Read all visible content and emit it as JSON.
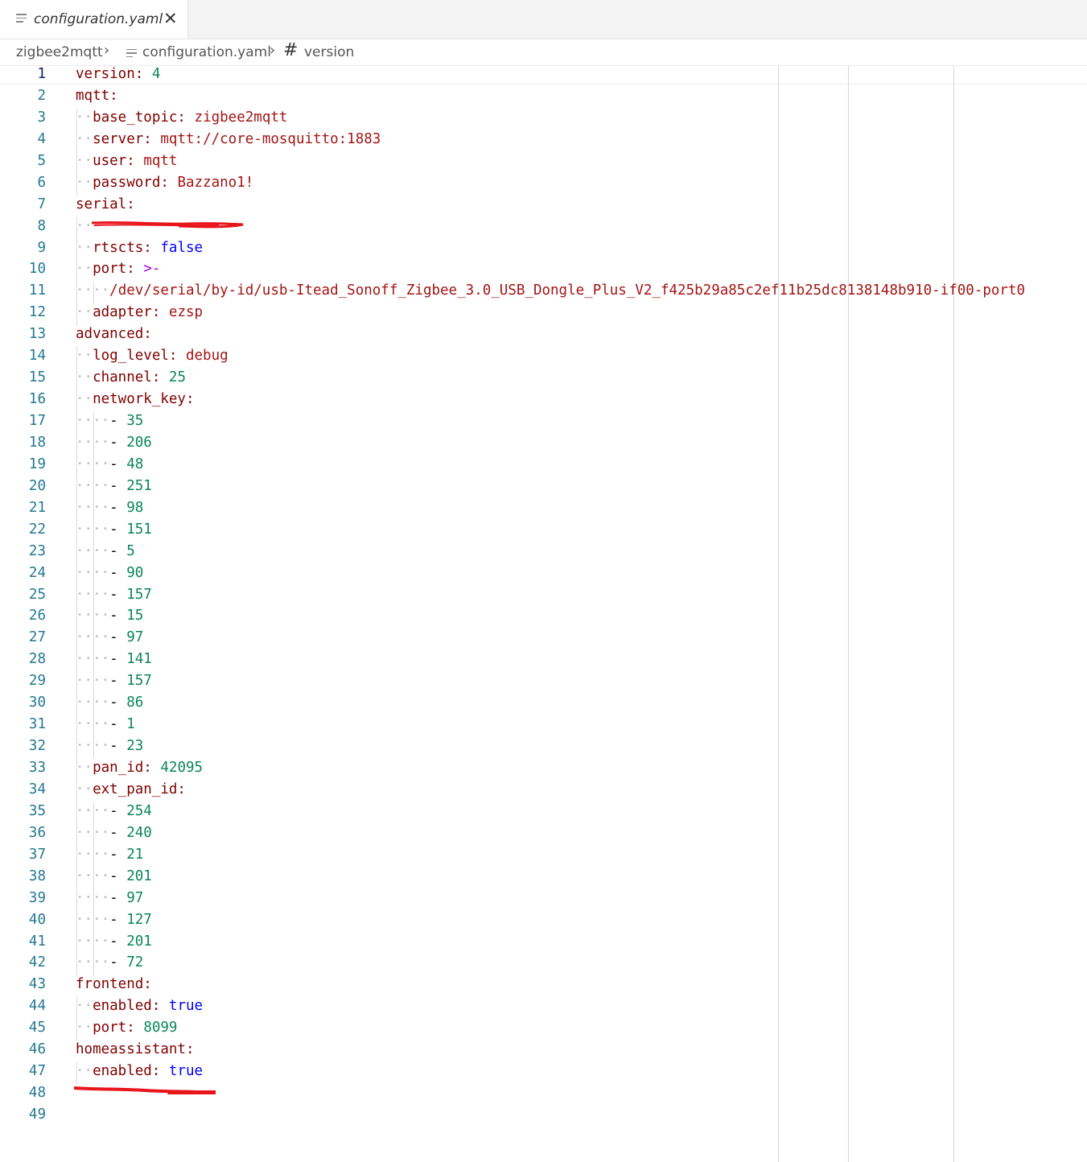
{
  "tab": {
    "title": "configuration.yaml",
    "close_glyph": "✕",
    "file_icon": "file-lines-icon"
  },
  "breadcrumb": {
    "folder": "zigbee2mqtt",
    "file": "configuration.yaml",
    "symbol_glyph": "#",
    "symbol": "version",
    "separator": "›"
  },
  "editor": {
    "active_line": 1,
    "colors": {
      "key": "#800000",
      "string": "#a31515",
      "number": "#098658",
      "boolean": "#0000ff",
      "operator": "#af00db",
      "line_number": "#237893",
      "redaction": "#e8151b"
    },
    "lines": [
      {
        "n": "1",
        "tokens": [
          {
            "t": "version:",
            "c": "k"
          },
          {
            "t": " "
          },
          {
            "t": "4",
            "c": "n"
          }
        ]
      },
      {
        "n": "2",
        "tokens": [
          {
            "t": "mqtt:",
            "c": "k"
          }
        ]
      },
      {
        "n": "3",
        "indent": 1,
        "tokens": [
          {
            "t": "base_topic:",
            "c": "k"
          },
          {
            "t": " "
          },
          {
            "t": "zigbee2mqtt",
            "c": "s"
          }
        ]
      },
      {
        "n": "4",
        "indent": 1,
        "tokens": [
          {
            "t": "server:",
            "c": "k"
          },
          {
            "t": " "
          },
          {
            "t": "mqtt://core-mosquitto:1883",
            "c": "s"
          }
        ]
      },
      {
        "n": "5",
        "indent": 1,
        "tokens": [
          {
            "t": "user:",
            "c": "k"
          },
          {
            "t": " "
          },
          {
            "t": "mqtt",
            "c": "s"
          }
        ]
      },
      {
        "n": "6",
        "indent": 1,
        "tokens": [
          {
            "t": "password:",
            "c": "k"
          },
          {
            "t": " "
          },
          {
            "t": "Bazzano1!",
            "c": "s"
          }
        ]
      },
      {
        "n": "7",
        "tokens": [
          {
            "t": "serial:",
            "c": "k"
          }
        ]
      },
      {
        "n": "8",
        "indent": 1,
        "redact": 1,
        "tokens": []
      },
      {
        "n": "9",
        "indent": 1,
        "tokens": [
          {
            "t": "rtscts:",
            "c": "k"
          },
          {
            "t": " "
          },
          {
            "t": "false",
            "c": "b"
          }
        ]
      },
      {
        "n": "10",
        "indent": 1,
        "tokens": [
          {
            "t": "port:",
            "c": "k"
          },
          {
            "t": " "
          },
          {
            "t": ">-",
            "c": "p"
          }
        ]
      },
      {
        "n": "11",
        "indent": 2,
        "tokens": [
          {
            "t": "/dev/serial/by-id/usb-Itead_Sonoff_Zigbee_3.0_USB_Dongle_Plus_V2_f425b29a85c2ef11b25dc8138148b910-if00-port0",
            "c": "s"
          }
        ]
      },
      {
        "n": "12",
        "indent": 1,
        "tokens": [
          {
            "t": "adapter:",
            "c": "k"
          },
          {
            "t": " "
          },
          {
            "t": "ezsp",
            "c": "s"
          }
        ]
      },
      {
        "n": "13",
        "tokens": [
          {
            "t": "advanced:",
            "c": "k"
          }
        ]
      },
      {
        "n": "14",
        "indent": 1,
        "tokens": [
          {
            "t": "log_level:",
            "c": "k"
          },
          {
            "t": " "
          },
          {
            "t": "debug",
            "c": "s"
          }
        ]
      },
      {
        "n": "15",
        "indent": 1,
        "tokens": [
          {
            "t": "channel:",
            "c": "k"
          },
          {
            "t": " "
          },
          {
            "t": "25",
            "c": "n"
          }
        ]
      },
      {
        "n": "16",
        "indent": 1,
        "tokens": [
          {
            "t": "network_key:",
            "c": "k"
          }
        ]
      },
      {
        "n": "17",
        "indent": 2,
        "tokens": [
          {
            "t": "- "
          },
          {
            "t": "35",
            "c": "n"
          }
        ]
      },
      {
        "n": "18",
        "indent": 2,
        "tokens": [
          {
            "t": "- "
          },
          {
            "t": "206",
            "c": "n"
          }
        ]
      },
      {
        "n": "19",
        "indent": 2,
        "tokens": [
          {
            "t": "- "
          },
          {
            "t": "48",
            "c": "n"
          }
        ]
      },
      {
        "n": "20",
        "indent": 2,
        "tokens": [
          {
            "t": "- "
          },
          {
            "t": "251",
            "c": "n"
          }
        ]
      },
      {
        "n": "21",
        "indent": 2,
        "tokens": [
          {
            "t": "- "
          },
          {
            "t": "98",
            "c": "n"
          }
        ]
      },
      {
        "n": "22",
        "indent": 2,
        "tokens": [
          {
            "t": "- "
          },
          {
            "t": "151",
            "c": "n"
          }
        ]
      },
      {
        "n": "23",
        "indent": 2,
        "tokens": [
          {
            "t": "- "
          },
          {
            "t": "5",
            "c": "n"
          }
        ]
      },
      {
        "n": "24",
        "indent": 2,
        "tokens": [
          {
            "t": "- "
          },
          {
            "t": "90",
            "c": "n"
          }
        ]
      },
      {
        "n": "25",
        "indent": 2,
        "tokens": [
          {
            "t": "- "
          },
          {
            "t": "157",
            "c": "n"
          }
        ]
      },
      {
        "n": "26",
        "indent": 2,
        "tokens": [
          {
            "t": "- "
          },
          {
            "t": "15",
            "c": "n"
          }
        ]
      },
      {
        "n": "27",
        "indent": 2,
        "tokens": [
          {
            "t": "- "
          },
          {
            "t": "97",
            "c": "n"
          }
        ]
      },
      {
        "n": "28",
        "indent": 2,
        "tokens": [
          {
            "t": "- "
          },
          {
            "t": "141",
            "c": "n"
          }
        ]
      },
      {
        "n": "29",
        "indent": 2,
        "tokens": [
          {
            "t": "- "
          },
          {
            "t": "157",
            "c": "n"
          }
        ]
      },
      {
        "n": "30",
        "indent": 2,
        "tokens": [
          {
            "t": "- "
          },
          {
            "t": "86",
            "c": "n"
          }
        ]
      },
      {
        "n": "31",
        "indent": 2,
        "tokens": [
          {
            "t": "- "
          },
          {
            "t": "1",
            "c": "n"
          }
        ]
      },
      {
        "n": "32",
        "indent": 2,
        "tokens": [
          {
            "t": "- "
          },
          {
            "t": "23",
            "c": "n"
          }
        ]
      },
      {
        "n": "33",
        "indent": 1,
        "tokens": [
          {
            "t": "pan_id:",
            "c": "k"
          },
          {
            "t": " "
          },
          {
            "t": "42095",
            "c": "n"
          }
        ]
      },
      {
        "n": "34",
        "indent": 1,
        "tokens": [
          {
            "t": "ext_pan_id:",
            "c": "k"
          }
        ]
      },
      {
        "n": "35",
        "indent": 2,
        "tokens": [
          {
            "t": "- "
          },
          {
            "t": "254",
            "c": "n"
          }
        ]
      },
      {
        "n": "36",
        "indent": 2,
        "tokens": [
          {
            "t": "- "
          },
          {
            "t": "240",
            "c": "n"
          }
        ]
      },
      {
        "n": "37",
        "indent": 2,
        "tokens": [
          {
            "t": "- "
          },
          {
            "t": "21",
            "c": "n"
          }
        ]
      },
      {
        "n": "38",
        "indent": 2,
        "tokens": [
          {
            "t": "- "
          },
          {
            "t": "201",
            "c": "n"
          }
        ]
      },
      {
        "n": "39",
        "indent": 2,
        "tokens": [
          {
            "t": "- "
          },
          {
            "t": "97",
            "c": "n"
          }
        ]
      },
      {
        "n": "40",
        "indent": 2,
        "tokens": [
          {
            "t": "- "
          },
          {
            "t": "127",
            "c": "n"
          }
        ]
      },
      {
        "n": "41",
        "indent": 2,
        "tokens": [
          {
            "t": "- "
          },
          {
            "t": "201",
            "c": "n"
          }
        ]
      },
      {
        "n": "42",
        "indent": 2,
        "tokens": [
          {
            "t": "- "
          },
          {
            "t": "72",
            "c": "n"
          }
        ]
      },
      {
        "n": "43",
        "tokens": [
          {
            "t": "frontend:",
            "c": "k"
          }
        ]
      },
      {
        "n": "44",
        "indent": 1,
        "tokens": [
          {
            "t": "enabled:",
            "c": "k"
          },
          {
            "t": " "
          },
          {
            "t": "true",
            "c": "b"
          }
        ]
      },
      {
        "n": "45",
        "indent": 1,
        "tokens": [
          {
            "t": "port:",
            "c": "k"
          },
          {
            "t": " "
          },
          {
            "t": "8099",
            "c": "n"
          }
        ]
      },
      {
        "n": "46",
        "tokens": [
          {
            "t": "homeassistant:",
            "c": "k"
          }
        ]
      },
      {
        "n": "47",
        "indent": 1,
        "tokens": [
          {
            "t": "enabled:",
            "c": "k"
          },
          {
            "t": " "
          },
          {
            "t": "true",
            "c": "b"
          }
        ]
      },
      {
        "n": "48",
        "redact": 2,
        "tokens": []
      },
      {
        "n": "49",
        "tokens": []
      }
    ]
  }
}
